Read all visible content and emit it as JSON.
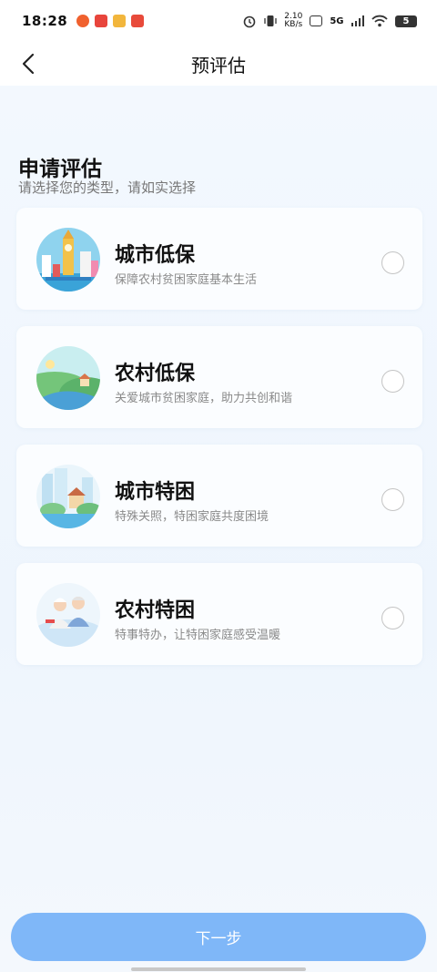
{
  "status_bar": {
    "time": "18:28",
    "net_speed_top": "2.10",
    "net_speed_bottom": "KB/s",
    "network": "5G",
    "battery": "5"
  },
  "nav": {
    "title": "预评估",
    "back_icon": "chevron-left-icon"
  },
  "section": {
    "title": "申请评估",
    "subtitle": "请选择您的类型，请如实选择"
  },
  "options": [
    {
      "title": "城市低保",
      "desc": "保障农村贫困家庭基本生活",
      "selected": false
    },
    {
      "title": "农村低保",
      "desc": "关爱城市贫困家庭，助力共创和谐",
      "selected": false
    },
    {
      "title": "城市特困",
      "desc": "特殊关照，特困家庭共度困境",
      "selected": false
    },
    {
      "title": "农村特困",
      "desc": "特事特办，让特困家庭感受温暖",
      "selected": false
    }
  ],
  "footer": {
    "next_label": "下一步"
  },
  "colors": {
    "primary_button": "#7fb7f8",
    "background": "#f3f8fe"
  }
}
